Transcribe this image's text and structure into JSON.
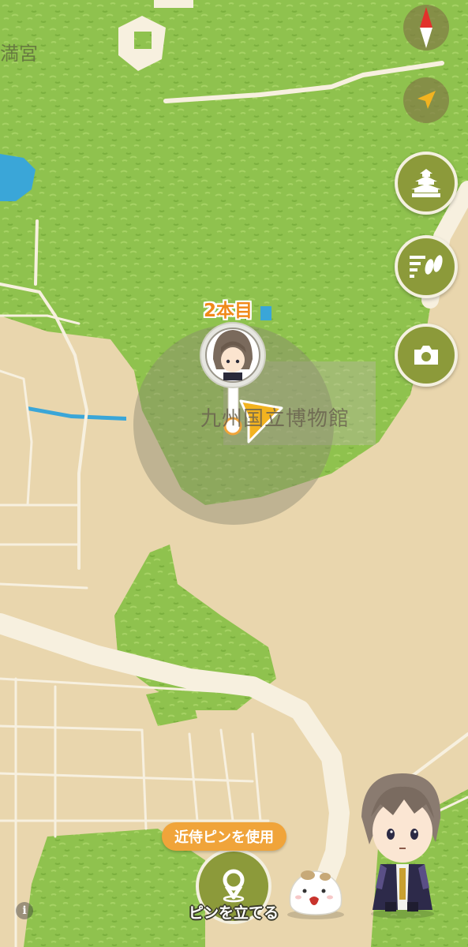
{
  "map": {
    "shrine_label": "満宮",
    "museum_label": "九州国立博物館",
    "pin_count_label": "2本目"
  },
  "controls": {
    "compass_icon": "compass-icon",
    "locate_icon": "location-arrow-icon",
    "castle_icon": "castle-icon",
    "footsteps_icon": "footsteps-icon",
    "camera_icon": "camera-icon"
  },
  "bottom": {
    "use_attendant_pin": "近侍ピンを使用",
    "place_pin": "ピンを立てる",
    "info": "i"
  },
  "colors": {
    "park_green": "#8cc04a",
    "land_beige": "#e9d6ad",
    "road": "#f7f0df",
    "water": "#3aa6d8",
    "button_olive": "#8c9a3a",
    "accent_orange": "#f0a43a"
  }
}
